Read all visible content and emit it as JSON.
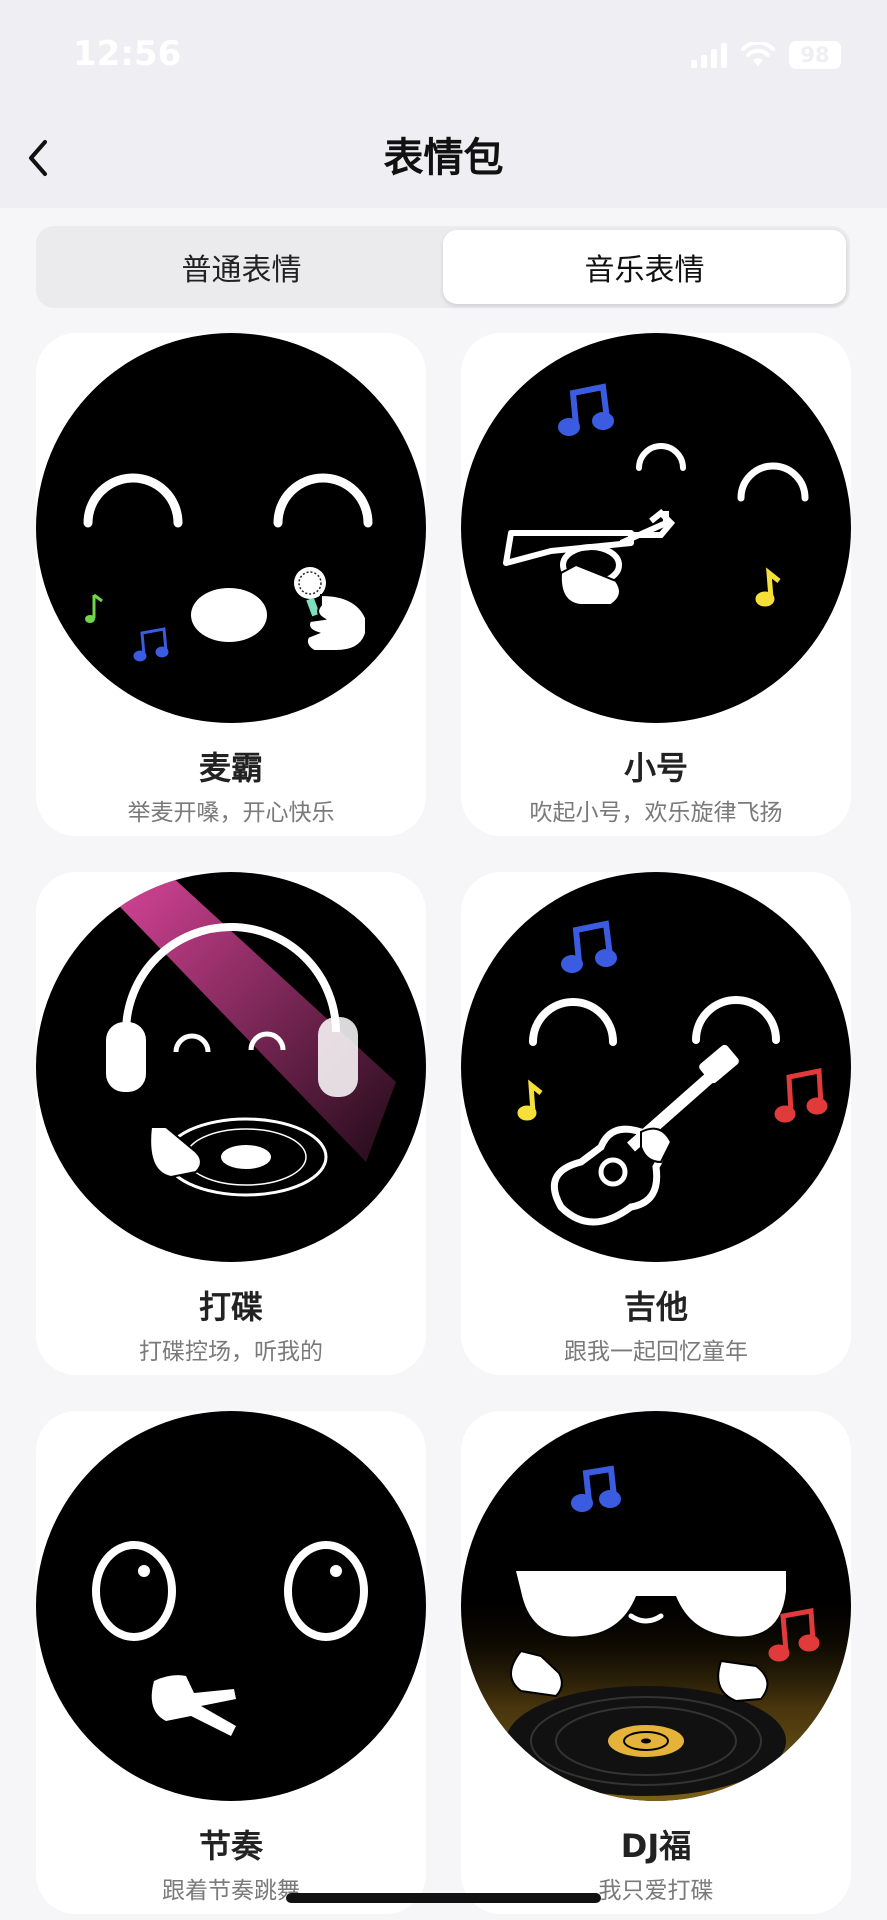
{
  "status_bar": {
    "time": "12:56",
    "battery": "98"
  },
  "header": {
    "title": "表情包"
  },
  "tabs": [
    {
      "label": "普通表情",
      "active": false
    },
    {
      "label": "音乐表情",
      "active": true
    }
  ],
  "stickers": [
    {
      "name": "麦霸",
      "desc": "举麦开嗓，开心快乐"
    },
    {
      "name": "小号",
      "desc": "吹起小号，欢乐旋律飞扬"
    },
    {
      "name": "打碟",
      "desc": "打碟控场，听我的"
    },
    {
      "name": "吉他",
      "desc": "跟我一起回忆童年"
    },
    {
      "name": "节奏",
      "desc": "跟着节奏跳舞"
    },
    {
      "name": "DJ福",
      "desc": "我只爱打碟"
    }
  ],
  "colors": {
    "note_blue": "#3b5be0",
    "note_yellow": "#f5e03a",
    "note_red": "#e03a3a",
    "note_green": "#6fd84a",
    "spotlight_pink": "#e0479e"
  }
}
